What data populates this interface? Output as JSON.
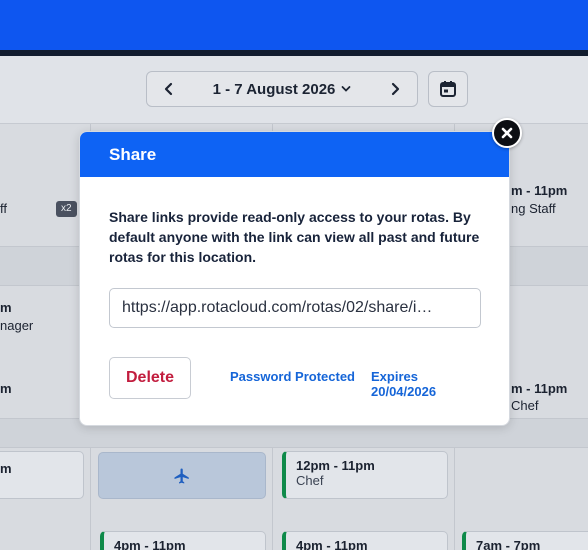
{
  "header": {
    "date_range": "1 - 7 August 2026"
  },
  "background": {
    "badge": "x2",
    "fragments": [
      {
        "text": "ff"
      },
      {
        "text": "m - 11pm"
      },
      {
        "text": "ng Staff"
      },
      {
        "text": "m"
      },
      {
        "text": "nager"
      },
      {
        "text": "m"
      },
      {
        "text": "m - 11pm"
      },
      {
        "text": "Chef"
      },
      {
        "text": "m"
      }
    ],
    "shifts": [
      {
        "time": "12pm - 11pm",
        "role": "Chef"
      },
      {
        "time": "4pm - 11pm"
      },
      {
        "time": "4pm - 11pm"
      },
      {
        "time": "7am - 7pm"
      }
    ]
  },
  "modal": {
    "title": "Share",
    "description": "Share links provide read-only access to your rotas. By default anyone with the link can view all past and future rotas for this location.",
    "link_value": "https://app.rotacloud.com/rotas/02/share/i…",
    "delete_label": "Delete",
    "password_label": "Password Protected",
    "expires_label": "Expires 20/04/2026"
  },
  "icons": {
    "prev": "chevron-left-icon",
    "next": "chevron-right-icon",
    "dropdown": "chevron-down-icon",
    "calendar": "calendar-icon",
    "close": "close-icon",
    "plane": "plane-icon"
  },
  "colors": {
    "brand": "#0e56f0",
    "modal_header": "#0e63f4",
    "danger": "#c21d3e",
    "link": "#1565d8",
    "shift_accent": "#0f8a4a"
  }
}
